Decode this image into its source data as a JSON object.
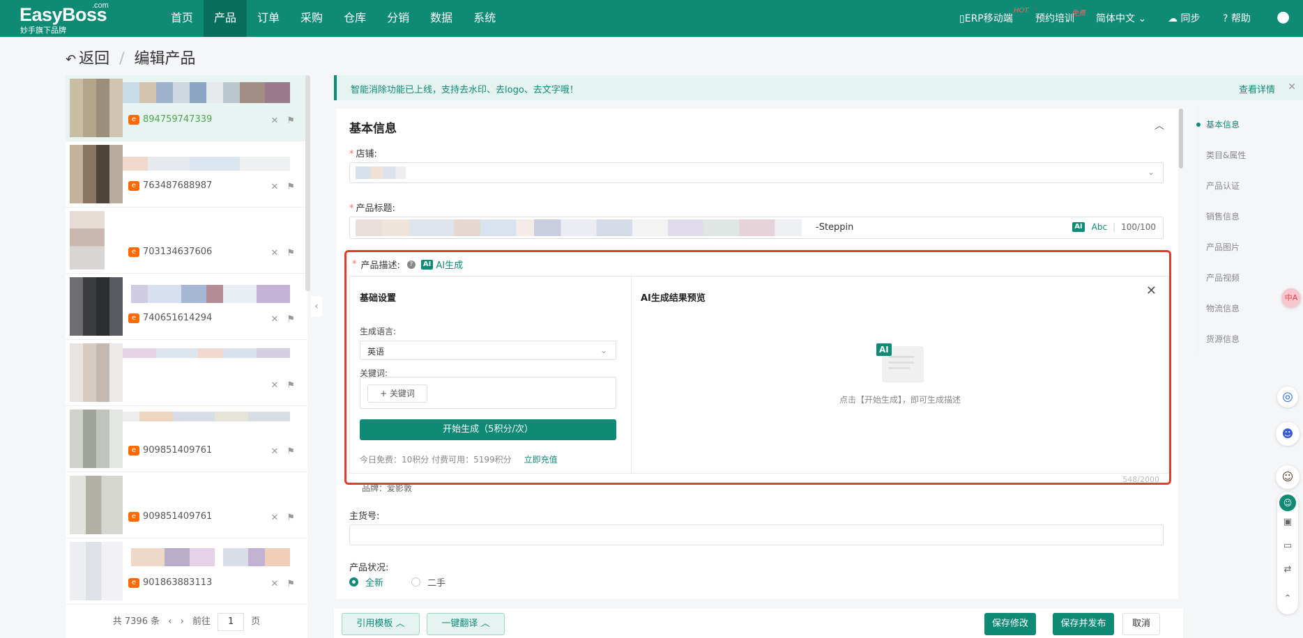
{
  "brand": {
    "name": "EasyBoss",
    "domain_suffix": ".com",
    "tagline": "妙手旗下品牌",
    "color": "#0e8a75"
  },
  "nav": {
    "items": [
      "首页",
      "产品",
      "订单",
      "采购",
      "仓库",
      "分销",
      "数据",
      "系统"
    ],
    "active_index": 1
  },
  "top_right": {
    "erp_mobile": "ERP移动端",
    "erp_badge": "HOT",
    "training": "预约培训",
    "training_badge": "免费",
    "language": "简体中文",
    "sync": "同步",
    "help": "帮助"
  },
  "breadcrumb": {
    "back": "返回",
    "separator": "/",
    "current": "编辑产品"
  },
  "product_list": {
    "items": [
      {
        "id": "894759747339",
        "active": true
      },
      {
        "id": "763487688987",
        "active": false
      },
      {
        "id": "703134637606",
        "active": false
      },
      {
        "id": "740651614294",
        "active": false
      },
      {
        "id": "",
        "active": false
      },
      {
        "id": "909851409761",
        "active": false
      },
      {
        "id": "909851409761",
        "active": false
      },
      {
        "id": "901863883113",
        "active": false
      }
    ],
    "pager": {
      "total": "共 7396 条",
      "goto": "前往",
      "page": "1",
      "page_unit": "页"
    }
  },
  "notice": {
    "text": "智能消除功能已上线，支持去水印、去logo、去文字哦！",
    "link": "查看详情"
  },
  "basic_info": {
    "title": "基本信息",
    "store_label": "店铺:",
    "product_title_label": "产品标题:",
    "product_title_suffix": "-Steppin",
    "title_ai": "AI",
    "title_abc": "Abc",
    "title_counter": "100/100",
    "desc_label": "产品描述:",
    "desc_ai_link": "AI生成",
    "desc_counter": "548/2000",
    "desc_brand_fragment": "品牌：爱影敦",
    "sku_label": "主货号:",
    "condition_label": "产品状况:",
    "condition_options": [
      "全新",
      "二手"
    ],
    "condition_selected": 0
  },
  "ai_panel": {
    "settings_title": "基础设置",
    "lang_label": "生成语言:",
    "lang_value": "英语",
    "keyword_label": "关键词:",
    "keyword_button": "+ 关键词",
    "generate_button": "开始生成（5积分/次）",
    "credit_text": "今日免费：10积分   付费可用：5199积分",
    "recharge": "立即充值",
    "preview_title": "AI生成结果预览",
    "empty_hint": "点击【开始生成】，即可生成描述",
    "illustration_badge": "AI"
  },
  "anchor_nav": {
    "items": [
      "基本信息",
      "类目&属性",
      "产品认证",
      "销售信息",
      "产品图片",
      "产品视频",
      "物流信息",
      "货源信息"
    ],
    "active_index": 0
  },
  "bottom_bar": {
    "template": "引用模板",
    "translate": "一键翻译",
    "save": "保存修改",
    "save_publish": "保存并发布",
    "cancel": "取消"
  }
}
